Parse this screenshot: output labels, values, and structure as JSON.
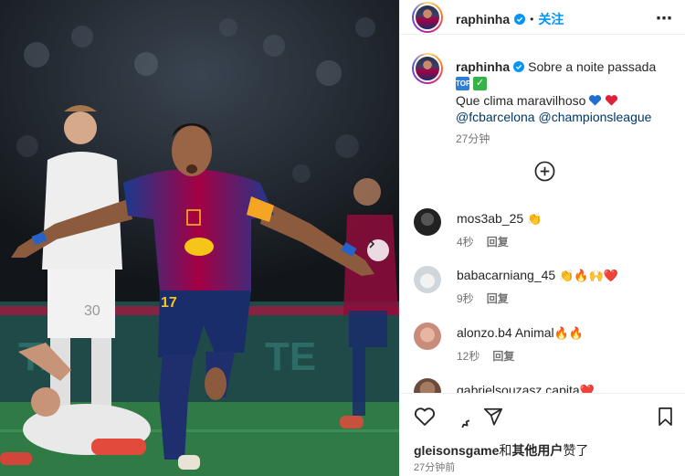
{
  "post": {
    "author": "raphinha",
    "follow_label": "关注",
    "separator": "•",
    "more_icon": "⋯"
  },
  "caption": {
    "author": "raphinha",
    "headline": "Sobre a noite passada",
    "emoji_line": [
      "🔝",
      "✅"
    ],
    "body": "Que clima maravilhoso",
    "body_emojis": [
      "💙",
      "❤️"
    ],
    "mentions": [
      "@fcbarcelona",
      "@championsleague"
    ],
    "time": "27分钟"
  },
  "comments": [
    {
      "user": "mos3ab_25",
      "text": "",
      "emojis": "👏",
      "time": "4秒",
      "reply": "回复"
    },
    {
      "user": "babacarniang_45",
      "text": "",
      "emojis": "👏🔥🙌❤️",
      "time": "9秒",
      "reply": "回复"
    },
    {
      "user": "alonzo.b4",
      "text": "Animal",
      "emojis": "🔥🔥",
      "time": "12秒",
      "reply": "回复"
    },
    {
      "user": "gabrielsouzasz",
      "text": "capita",
      "emojis": "❤️",
      "time": "",
      "reply": ""
    }
  ],
  "likes": {
    "user": "gleisonsgame",
    "connector": "和",
    "others": "其他用户",
    "suffix": "赞了"
  },
  "posted": "27分钟前",
  "colors": {
    "follow": "#0095f6",
    "mention": "#00376b",
    "barca_blue": "#1a3a8f",
    "barca_red": "#a50044",
    "like_heart": "#ed4956"
  }
}
